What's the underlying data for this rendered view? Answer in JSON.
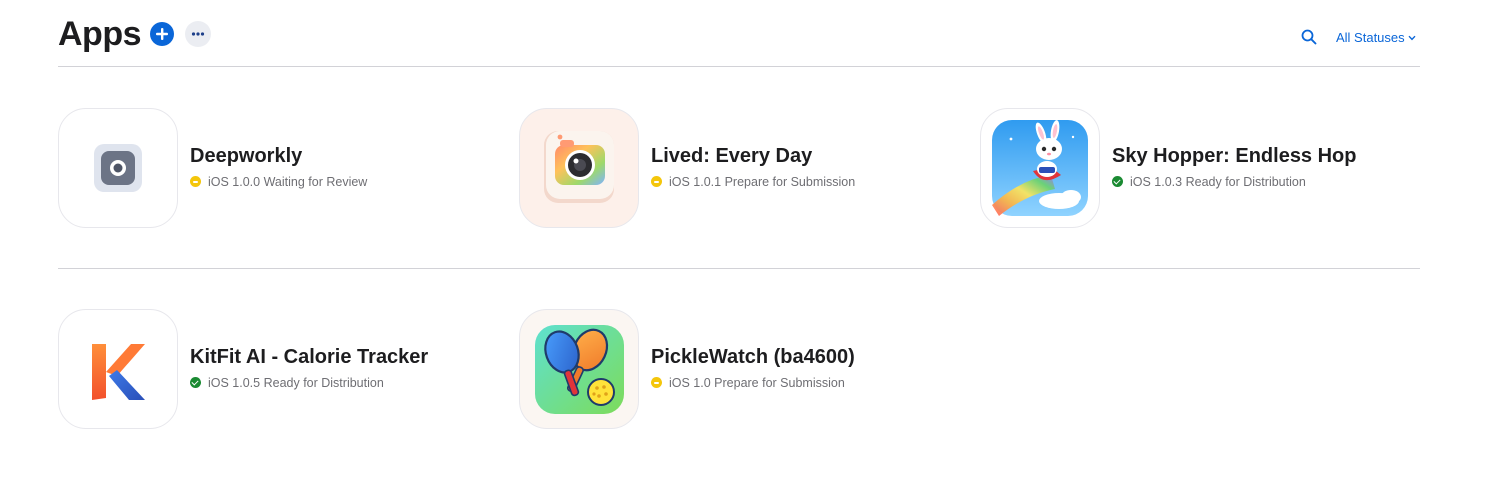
{
  "header": {
    "title": "Apps",
    "add_icon": "plus-circle-icon",
    "more_icon": "ellipsis-icon",
    "search_icon": "search-icon",
    "status_filter_label": "All Statuses",
    "accent_color": "#0a66d8"
  },
  "apps": [
    {
      "name": "Deepworkly",
      "platform": "iOS",
      "version": "1.0.0",
      "status": "Waiting for Review",
      "status_line": "iOS 1.0.0 Waiting for Review",
      "status_color": "yellow"
    },
    {
      "name": "Lived: Every Day",
      "platform": "iOS",
      "version": "1.0.1",
      "status": "Prepare for Submission",
      "status_line": "iOS 1.0.1 Prepare for Submission",
      "status_color": "yellow"
    },
    {
      "name": "Sky Hopper: Endless Hop",
      "platform": "iOS",
      "version": "1.0.3",
      "status": "Ready for Distribution",
      "status_line": "iOS 1.0.3 Ready for Distribution",
      "status_color": "green"
    },
    {
      "name": "KitFit AI - Calorie Tracker",
      "platform": "iOS",
      "version": "1.0.5",
      "status": "Ready for Distribution",
      "status_line": "iOS 1.0.5 Ready for Distribution",
      "status_color": "green"
    },
    {
      "name": "PickleWatch (ba4600)",
      "platform": "iOS",
      "version": "1.0",
      "status": "Prepare for Submission",
      "status_line": "iOS 1.0 Prepare for Submission",
      "status_color": "yellow"
    }
  ],
  "status_colors": {
    "yellow": "#f4c60b",
    "green": "#1a8a32"
  }
}
